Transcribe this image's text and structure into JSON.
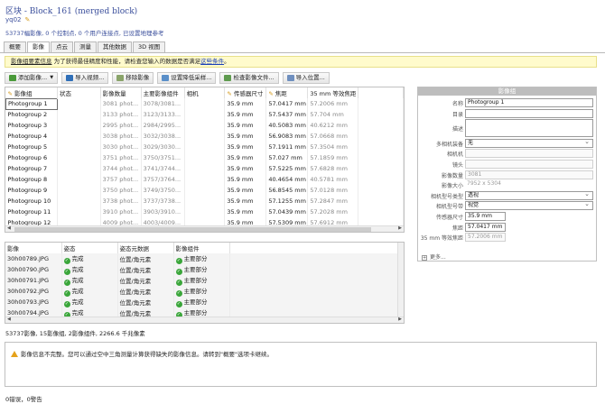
{
  "header": {
    "title": "区块 - Block_161 (merged block)",
    "subtitle": "yq02",
    "summary": "53737幅影像, 0 个控制点, 0 个用户连接点, 已设置地理参考"
  },
  "tabs": [
    {
      "label": "概要"
    },
    {
      "label": "影像"
    },
    {
      "label": "点云"
    },
    {
      "label": "测量"
    },
    {
      "label": "其他数据"
    },
    {
      "label": "3D 视图"
    }
  ],
  "warning_bar": {
    "underlined": "影像组要素信息",
    "text": " 为了获得最佳精度和性能，请检查您输入的数据是否满足",
    "link": "这些条件",
    "end": "。"
  },
  "toolbar": [
    {
      "label": "添加影像...",
      "icon": "add-photo-icon",
      "dropdown": true
    },
    {
      "label": "导入视频...",
      "icon": "film-icon",
      "dropdown": false
    },
    {
      "label": "移除影像",
      "icon": "remove-photo-icon",
      "dropdown": false
    },
    {
      "label": "设置降低采样...",
      "icon": "downsample-icon",
      "dropdown": false
    },
    {
      "label": "检查影像文件...",
      "icon": "check-file-icon",
      "dropdown": false
    },
    {
      "label": "导入位置...",
      "icon": "import-position-icon",
      "dropdown": false
    }
  ],
  "photogroups": {
    "columns": [
      "影像组",
      "状态",
      "影像数量",
      "主要影像组件",
      "相机",
      "传感器尺寸",
      "焦距",
      "35 mm 等效焦距"
    ],
    "rows": [
      [
        "Photogroup 1",
        "",
        "3081 phot...",
        "3078/3081...",
        "",
        "35.9 mm",
        "57.0417 mm",
        "57.2006 mm"
      ],
      [
        "Photogroup 2",
        "",
        "3133 phot...",
        "3123/3133...",
        "",
        "35.9 mm",
        "57.5437 mm",
        "57.704 mm"
      ],
      [
        "Photogroup 3",
        "",
        "2995 phot...",
        "2984/2995...",
        "",
        "35.9 mm",
        "40.5083 mm",
        "40.6212 mm"
      ],
      [
        "Photogroup 4",
        "",
        "3038 phot...",
        "3032/3038...",
        "",
        "35.9 mm",
        "56.9083 mm",
        "57.0668 mm"
      ],
      [
        "Photogroup 5",
        "",
        "3030 phot...",
        "3029/3030...",
        "",
        "35.9 mm",
        "57.1911 mm",
        "57.3504 mm"
      ],
      [
        "Photogroup 6",
        "",
        "3751 phot...",
        "3750/3751...",
        "",
        "35.9 mm",
        "57.027 mm",
        "57.1859 mm"
      ],
      [
        "Photogroup 7",
        "",
        "3744 phot...",
        "3741/3744...",
        "",
        "35.9 mm",
        "57.5225 mm",
        "57.6828 mm"
      ],
      [
        "Photogroup 8",
        "",
        "3757 phot...",
        "3757/3764...",
        "",
        "35.9 mm",
        "40.4654 mm",
        "40.5781 mm"
      ],
      [
        "Photogroup 9",
        "",
        "3750 phot...",
        "3749/3750...",
        "",
        "35.9 mm",
        "56.8545 mm",
        "57.0128 mm"
      ],
      [
        "Photogroup 10",
        "",
        "3738 phot...",
        "3737/3738...",
        "",
        "35.9 mm",
        "57.1255 mm",
        "57.2847 mm"
      ],
      [
        "Photogroup 11",
        "",
        "3910 phot...",
        "3903/3910...",
        "",
        "35.9 mm",
        "57.0439 mm",
        "57.2028 mm"
      ],
      [
        "Photogroup 12",
        "",
        "4009 phot...",
        "4003/4009...",
        "",
        "35.9 mm",
        "57.5309 mm",
        "57.6912 mm"
      ]
    ]
  },
  "photos": {
    "columns": [
      "影像",
      "姿态",
      "姿态元数据",
      "影像组件"
    ],
    "rows": [
      [
        "30h00789.JPG",
        "完成",
        "位置/角元素",
        "主要部分"
      ],
      [
        "30h00790.JPG",
        "完成",
        "位置/角元素",
        "主要部分"
      ],
      [
        "30h00791.JPG",
        "完成",
        "位置/角元素",
        "主要部分"
      ],
      [
        "30h00792.JPG",
        "完成",
        "位置/角元素",
        "主要部分"
      ],
      [
        "30h00793.JPG",
        "完成",
        "位置/角元素",
        "主要部分"
      ],
      [
        "30h00794.JPG",
        "完成",
        "位置/角元素",
        "主要部分"
      ]
    ]
  },
  "status_line": "53737影像, 15影像组, 2影像组件, 2266.6 千兆像素",
  "properties": {
    "header": "影像组",
    "fields": [
      {
        "label": "名称",
        "value": "Photogroup 1",
        "style": "edit"
      },
      {
        "label": "目录",
        "value": "",
        "style": "edit"
      },
      {
        "label": "描述",
        "value": "",
        "style": "edit-tall"
      },
      {
        "label": "多相机装备",
        "value": "无",
        "style": "select"
      },
      {
        "label": "相机机",
        "value": "",
        "style": "dis"
      },
      {
        "label": "镜头",
        "value": "",
        "style": "dis"
      },
      {
        "label": "影像数量",
        "value": "3081",
        "style": "dis"
      },
      {
        "label": "影像大小",
        "value": "7952 x 5304",
        "style": "nob"
      },
      {
        "label": "相机型号类型",
        "value": "透视",
        "style": "select"
      },
      {
        "label": "相机型号带",
        "value": "视觉",
        "style": "select"
      },
      {
        "label": "传感器尺寸",
        "value": "35.9 mm",
        "style": "edit-short"
      },
      {
        "label": "焦距",
        "value": "57.0417 mm",
        "style": "edit-short"
      },
      {
        "label": "35 mm 等效焦距",
        "value": "57.2006 mm",
        "style": "dis-short"
      }
    ],
    "more": "更多..."
  },
  "message": "影像信息不完整。您可以通过空中三角测量计算获得缺失的影像信息。请转到\"概要\"选项卡继续。",
  "footer": "0错误，0警告"
}
